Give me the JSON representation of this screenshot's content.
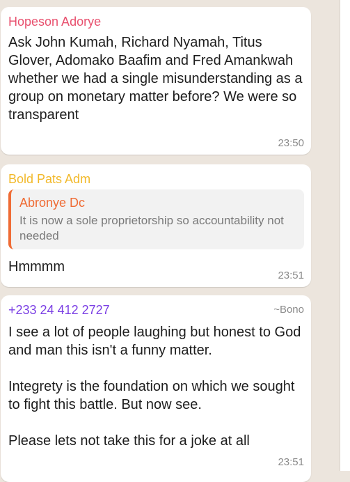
{
  "colors": {
    "chat_background": "#ece5dd",
    "bubble": "#ffffff",
    "sender_1": "#e8506e",
    "sender_2": "#f2b92a",
    "sender_3": "#7b3fe4",
    "quote_author": "#ef6c35",
    "timestamp": "#8a8a8a"
  },
  "messages": [
    {
      "sender": "Hopeson Adorye",
      "text": "Ask John Kumah, Richard Nyamah, Titus Glover, Adomako Baafim and Fred Amankwah whether we had a single misunderstanding as a group on monetary matter before? We were so transparent",
      "time": "23:50"
    },
    {
      "sender": "Bold Pats Adm",
      "quote": {
        "author": "Abronye Dc",
        "text": "It is now a sole proprietorship so accountability not needed"
      },
      "text": "Hmmmm",
      "time": "23:51"
    },
    {
      "sender": "+233 24 412 2727",
      "push_name": "~Bono",
      "text": "I see a lot of people laughing but honest to God and man this isn't a funny matter.\n\nIntegrety is the foundation on which we sought to fight this battle. But now see.\n\nPlease lets not take this for a joke at all",
      "time": "23:51"
    }
  ]
}
